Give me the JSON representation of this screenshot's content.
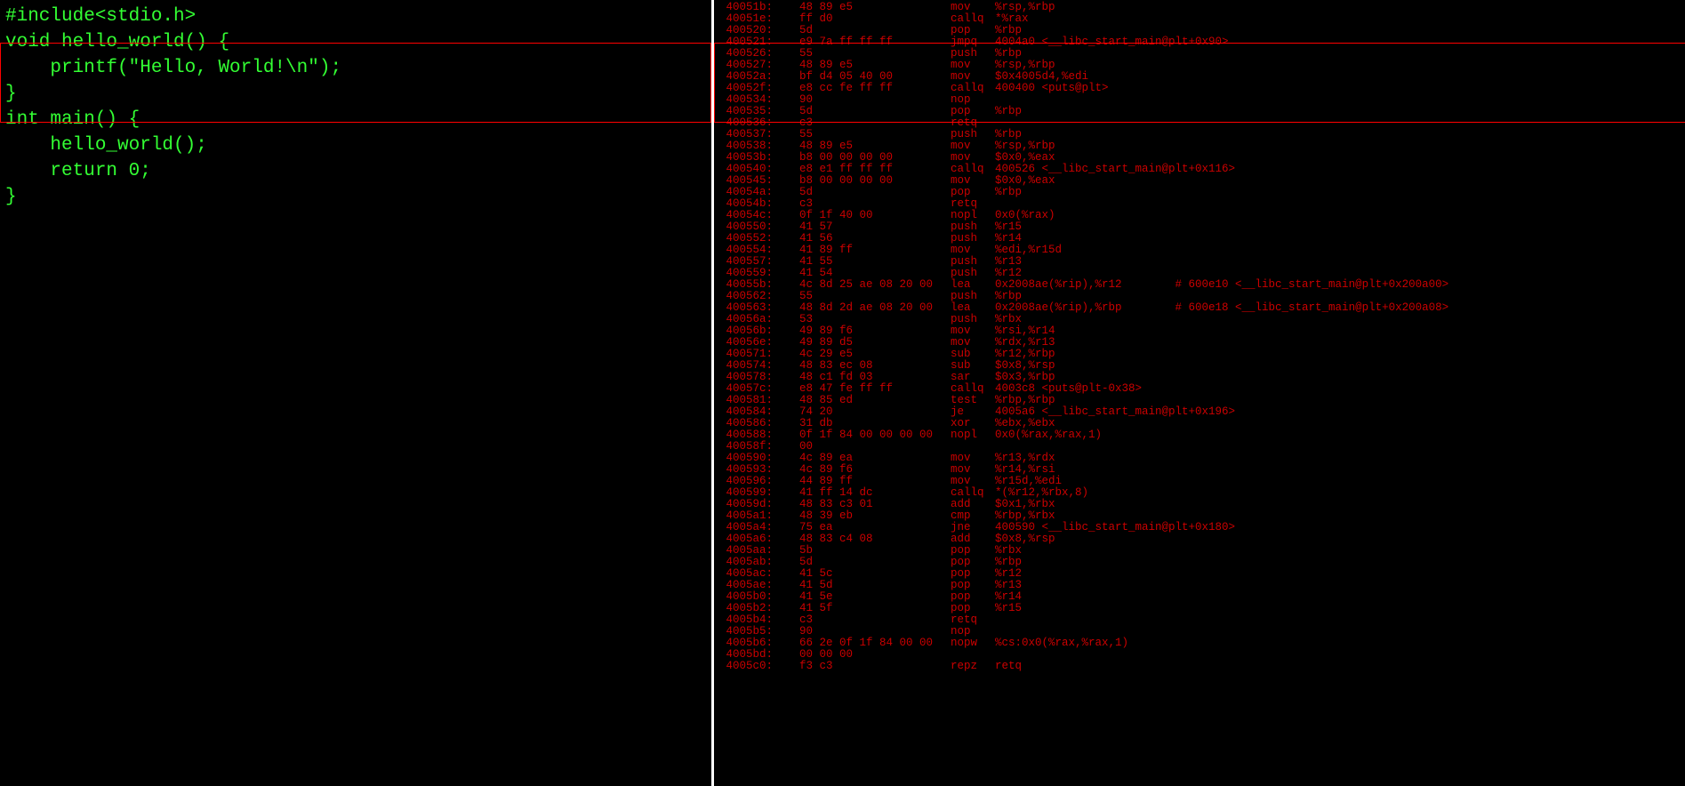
{
  "source": {
    "lines": [
      "#include<stdio.h>",
      "",
      "void hello_world() {",
      "    printf(\"Hello, World!\\n\");",
      "}",
      "",
      "int main() {",
      "    hello_world();",
      "    return 0;",
      "}"
    ]
  },
  "asm": [
    {
      "addr": "40051b:",
      "bytes": "48 89 e5",
      "mn": "mov",
      "op": "%rsp,%rbp"
    },
    {
      "addr": "40051e:",
      "bytes": "ff d0",
      "mn": "callq",
      "op": "*%rax"
    },
    {
      "addr": "400520:",
      "bytes": "5d",
      "mn": "pop",
      "op": "%rbp"
    },
    {
      "addr": "400521:",
      "bytes": "e9 7a ff ff ff",
      "mn": "jmpq",
      "op": "4004a0 <__libc_start_main@plt+0x90>"
    },
    {
      "addr": "400526:",
      "bytes": "55",
      "mn": "push",
      "op": "%rbp"
    },
    {
      "addr": "400527:",
      "bytes": "48 89 e5",
      "mn": "mov",
      "op": "%rsp,%rbp"
    },
    {
      "addr": "40052a:",
      "bytes": "bf d4 05 40 00",
      "mn": "mov",
      "op": "$0x4005d4,%edi"
    },
    {
      "addr": "40052f:",
      "bytes": "e8 cc fe ff ff",
      "mn": "callq",
      "op": "400400 <puts@plt>"
    },
    {
      "addr": "400534:",
      "bytes": "90",
      "mn": "nop",
      "op": ""
    },
    {
      "addr": "400535:",
      "bytes": "5d",
      "mn": "pop",
      "op": "%rbp"
    },
    {
      "addr": "400536:",
      "bytes": "c3",
      "mn": "retq",
      "op": ""
    },
    {
      "addr": "400537:",
      "bytes": "55",
      "mn": "push",
      "op": "%rbp"
    },
    {
      "addr": "400538:",
      "bytes": "48 89 e5",
      "mn": "mov",
      "op": "%rsp,%rbp"
    },
    {
      "addr": "40053b:",
      "bytes": "b8 00 00 00 00",
      "mn": "mov",
      "op": "$0x0,%eax"
    },
    {
      "addr": "400540:",
      "bytes": "e8 e1 ff ff ff",
      "mn": "callq",
      "op": "400526 <__libc_start_main@plt+0x116>"
    },
    {
      "addr": "400545:",
      "bytes": "b8 00 00 00 00",
      "mn": "mov",
      "op": "$0x0,%eax"
    },
    {
      "addr": "40054a:",
      "bytes": "5d",
      "mn": "pop",
      "op": "%rbp"
    },
    {
      "addr": "40054b:",
      "bytes": "c3",
      "mn": "retq",
      "op": ""
    },
    {
      "addr": "40054c:",
      "bytes": "0f 1f 40 00",
      "mn": "nopl",
      "op": "0x0(%rax)"
    },
    {
      "addr": "400550:",
      "bytes": "41 57",
      "mn": "push",
      "op": "%r15"
    },
    {
      "addr": "400552:",
      "bytes": "41 56",
      "mn": "push",
      "op": "%r14"
    },
    {
      "addr": "400554:",
      "bytes": "41 89 ff",
      "mn": "mov",
      "op": "%edi,%r15d"
    },
    {
      "addr": "400557:",
      "bytes": "41 55",
      "mn": "push",
      "op": "%r13"
    },
    {
      "addr": "400559:",
      "bytes": "41 54",
      "mn": "push",
      "op": "%r12"
    },
    {
      "addr": "40055b:",
      "bytes": "4c 8d 25 ae 08 20 00",
      "mn": "lea",
      "op": "0x2008ae(%rip),%r12",
      "comment": "# 600e10 <__libc_start_main@plt+0x200a00>"
    },
    {
      "addr": "400562:",
      "bytes": "55",
      "mn": "push",
      "op": "%rbp"
    },
    {
      "addr": "400563:",
      "bytes": "48 8d 2d ae 08 20 00",
      "mn": "lea",
      "op": "0x2008ae(%rip),%rbp",
      "comment": "# 600e18 <__libc_start_main@plt+0x200a08>"
    },
    {
      "addr": "40056a:",
      "bytes": "53",
      "mn": "push",
      "op": "%rbx"
    },
    {
      "addr": "40056b:",
      "bytes": "49 89 f6",
      "mn": "mov",
      "op": "%rsi,%r14"
    },
    {
      "addr": "40056e:",
      "bytes": "49 89 d5",
      "mn": "mov",
      "op": "%rdx,%r13"
    },
    {
      "addr": "400571:",
      "bytes": "4c 29 e5",
      "mn": "sub",
      "op": "%r12,%rbp"
    },
    {
      "addr": "400574:",
      "bytes": "48 83 ec 08",
      "mn": "sub",
      "op": "$0x8,%rsp"
    },
    {
      "addr": "400578:",
      "bytes": "48 c1 fd 03",
      "mn": "sar",
      "op": "$0x3,%rbp"
    },
    {
      "addr": "40057c:",
      "bytes": "e8 47 fe ff ff",
      "mn": "callq",
      "op": "4003c8 <puts@plt-0x38>"
    },
    {
      "addr": "400581:",
      "bytes": "48 85 ed",
      "mn": "test",
      "op": "%rbp,%rbp"
    },
    {
      "addr": "400584:",
      "bytes": "74 20",
      "mn": "je",
      "op": "4005a6 <__libc_start_main@plt+0x196>"
    },
    {
      "addr": "400586:",
      "bytes": "31 db",
      "mn": "xor",
      "op": "%ebx,%ebx"
    },
    {
      "addr": "400588:",
      "bytes": "0f 1f 84 00 00 00 00",
      "mn": "nopl",
      "op": "0x0(%rax,%rax,1)"
    },
    {
      "addr": "40058f:",
      "bytes": "00",
      "mn": "",
      "op": ""
    },
    {
      "addr": "400590:",
      "bytes": "4c 89 ea",
      "mn": "mov",
      "op": "%r13,%rdx"
    },
    {
      "addr": "400593:",
      "bytes": "4c 89 f6",
      "mn": "mov",
      "op": "%r14,%rsi"
    },
    {
      "addr": "400596:",
      "bytes": "44 89 ff",
      "mn": "mov",
      "op": "%r15d,%edi"
    },
    {
      "addr": "400599:",
      "bytes": "41 ff 14 dc",
      "mn": "callq",
      "op": "*(%r12,%rbx,8)"
    },
    {
      "addr": "40059d:",
      "bytes": "48 83 c3 01",
      "mn": "add",
      "op": "$0x1,%rbx"
    },
    {
      "addr": "4005a1:",
      "bytes": "48 39 eb",
      "mn": "cmp",
      "op": "%rbp,%rbx"
    },
    {
      "addr": "4005a4:",
      "bytes": "75 ea",
      "mn": "jne",
      "op": "400590 <__libc_start_main@plt+0x180>"
    },
    {
      "addr": "4005a6:",
      "bytes": "48 83 c4 08",
      "mn": "add",
      "op": "$0x8,%rsp"
    },
    {
      "addr": "4005aa:",
      "bytes": "5b",
      "mn": "pop",
      "op": "%rbx"
    },
    {
      "addr": "4005ab:",
      "bytes": "5d",
      "mn": "pop",
      "op": "%rbp"
    },
    {
      "addr": "4005ac:",
      "bytes": "41 5c",
      "mn": "pop",
      "op": "%r12"
    },
    {
      "addr": "4005ae:",
      "bytes": "41 5d",
      "mn": "pop",
      "op": "%r13"
    },
    {
      "addr": "4005b0:",
      "bytes": "41 5e",
      "mn": "pop",
      "op": "%r14"
    },
    {
      "addr": "4005b2:",
      "bytes": "41 5f",
      "mn": "pop",
      "op": "%r15"
    },
    {
      "addr": "4005b4:",
      "bytes": "c3",
      "mn": "retq",
      "op": ""
    },
    {
      "addr": "4005b5:",
      "bytes": "90",
      "mn": "nop",
      "op": ""
    },
    {
      "addr": "4005b6:",
      "bytes": "66 2e 0f 1f 84 00 00",
      "mn": "nopw",
      "op": "%cs:0x0(%rax,%rax,1)"
    },
    {
      "addr": "4005bd:",
      "bytes": "00 00 00",
      "mn": "",
      "op": ""
    },
    {
      "addr": "4005c0:",
      "bytes": "f3 c3",
      "mn": "repz",
      "op": "retq"
    }
  ]
}
